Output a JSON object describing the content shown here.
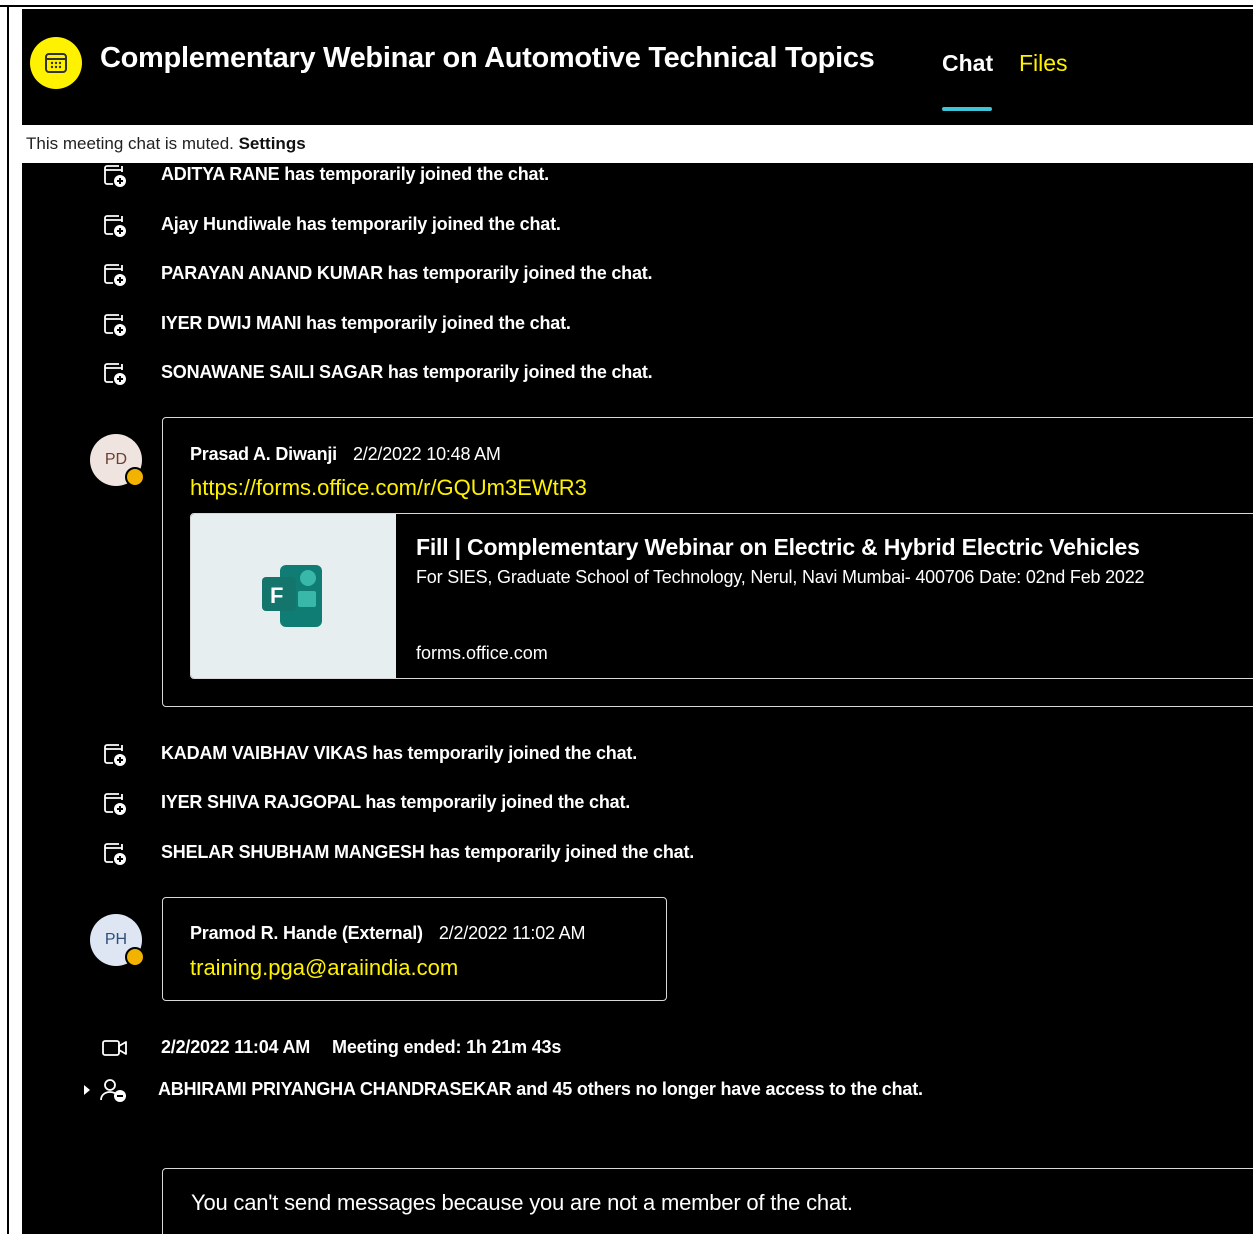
{
  "header": {
    "title": "Complementary Webinar on Automotive Technical Topics",
    "tabs": [
      {
        "label": "Chat",
        "active": true
      },
      {
        "label": "Files",
        "active": false
      }
    ],
    "accent_color": "#fff200",
    "tab_underline_color": "#3fc3d6"
  },
  "muted_bar": {
    "text": "This meeting chat is muted. ",
    "settings_label": "Settings"
  },
  "events_top": [
    {
      "icon": "chat-join-icon",
      "text": "ADITYA RANE has temporarily joined the chat."
    },
    {
      "icon": "chat-join-icon",
      "text": "Ajay Hundiwale has temporarily joined the chat."
    },
    {
      "icon": "chat-join-icon",
      "text": "PARAYAN ANAND KUMAR has temporarily joined the chat."
    },
    {
      "icon": "chat-join-icon",
      "text": "IYER DWIJ MANI has temporarily joined the chat."
    },
    {
      "icon": "chat-join-icon",
      "text": "SONAWANE SAILI SAGAR has temporarily joined the chat."
    }
  ],
  "message1": {
    "avatar_initials": "PD",
    "sender": "Prasad A. Diwanji",
    "timestamp": "2/2/2022 10:48 AM",
    "link": "https://forms.office.com/r/GQUm3EWtR3",
    "preview": {
      "title": "Fill | Complementary Webinar on Electric & Hybrid Electric Vehicles",
      "description": "For SIES, Graduate School of Technology, Nerul, Navi Mumbai- 400706 Date: 02nd Feb 2022",
      "domain": "forms.office.com",
      "icon": "microsoft-forms-icon"
    }
  },
  "events_middle": [
    {
      "icon": "chat-join-icon",
      "text": "KADAM VAIBHAV VIKAS has temporarily joined the chat."
    },
    {
      "icon": "chat-join-icon",
      "text": "IYER SHIVA RAJGOPAL has temporarily joined the chat."
    },
    {
      "icon": "chat-join-icon",
      "text": "SHELAR SHUBHAM MANGESH has temporarily joined the chat."
    }
  ],
  "message2": {
    "avatar_initials": "PH",
    "sender": "Pramod R. Hande (External)",
    "timestamp": "2/2/2022 11:02 AM",
    "link": "training.pga@araiindia.com"
  },
  "meeting_ended": {
    "icon": "video-camera-icon",
    "timestamp": "2/2/2022 11:04 AM",
    "label": "Meeting ended: ",
    "duration": "1h 21m 43s"
  },
  "access_removed": {
    "icon": "person-remove-icon",
    "text": "ABHIRAMI PRIYANGHA CHANDRASEKAR and 45 others no longer have access to the chat."
  },
  "composer": {
    "text": "You can't send messages because you are not a member of the chat."
  }
}
